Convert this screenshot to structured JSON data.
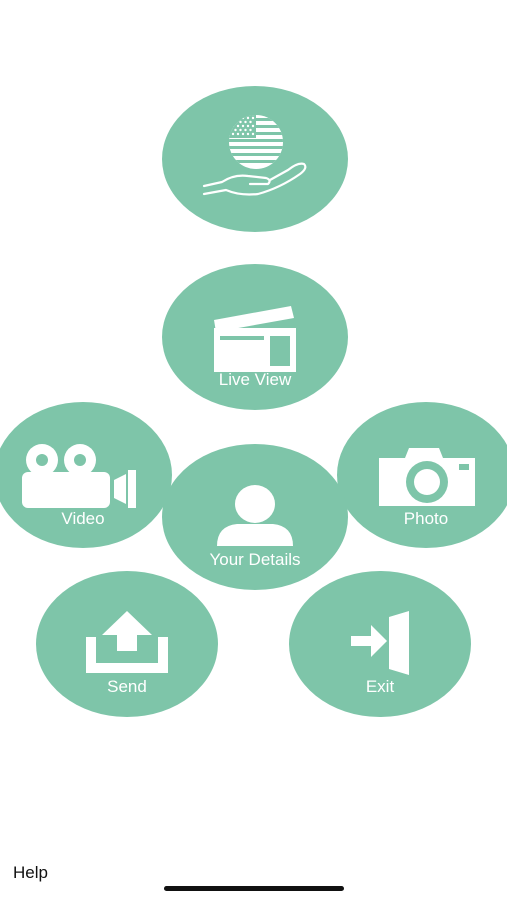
{
  "theme": {
    "accent": "#7ec5a9",
    "icon_color": "#ffffff",
    "background": "#ffffff"
  },
  "menu": {
    "flag_button": {
      "icon": "us-flag-in-hand-icon"
    },
    "live_view": {
      "label": "Live View",
      "icon": "clapperboard-icon"
    },
    "video": {
      "label": "Video",
      "icon": "video-camera-icon"
    },
    "photo": {
      "label": "Photo",
      "icon": "camera-icon"
    },
    "your_details": {
      "label": "Your Details",
      "icon": "user-icon"
    },
    "send": {
      "label": "Send",
      "icon": "upload-icon"
    },
    "exit": {
      "label": "Exit",
      "icon": "exit-door-icon"
    }
  },
  "footer": {
    "help_label": "Help"
  }
}
